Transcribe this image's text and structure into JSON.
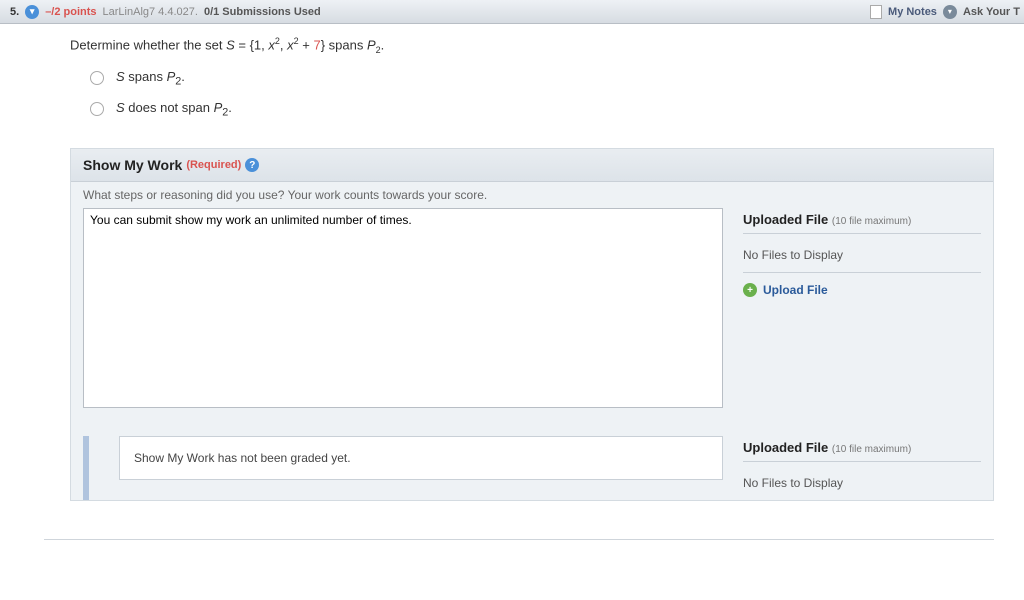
{
  "topbar": {
    "question_number": "5.",
    "points": "–/2 points",
    "source": "LarLinAlg7 4.4.027.",
    "submissions": "0/1 Submissions Used",
    "my_notes": "My Notes",
    "ask": "Ask Your T"
  },
  "question": {
    "prefix": "Determine whether the set  ",
    "set_label": "S",
    "equals": " = {1, ",
    "t1": "x",
    "t2": ", ",
    "t3": "x",
    "t4": " + ",
    "seven": "7",
    "t5": "}  spans ",
    "space": "P",
    "period": "."
  },
  "options": {
    "a_prefix": "S",
    "a_text": " spans ",
    "a_space": "P",
    "a_period": ".",
    "b_prefix": "S",
    "b_text": " does not span ",
    "b_space": "P",
    "b_period": "."
  },
  "smw": {
    "title": "Show My Work",
    "required": "(Required)",
    "subtitle": "What steps or reasoning did you use? Your work counts towards your score.",
    "placeholder": "You can submit show my work an unlimited number of times.",
    "not_graded": "Show My Work has not been graded yet."
  },
  "upload": {
    "header": "Uploaded File",
    "max": "(10 file maximum)",
    "nofiles": "No Files to Display",
    "link": "Upload File"
  }
}
